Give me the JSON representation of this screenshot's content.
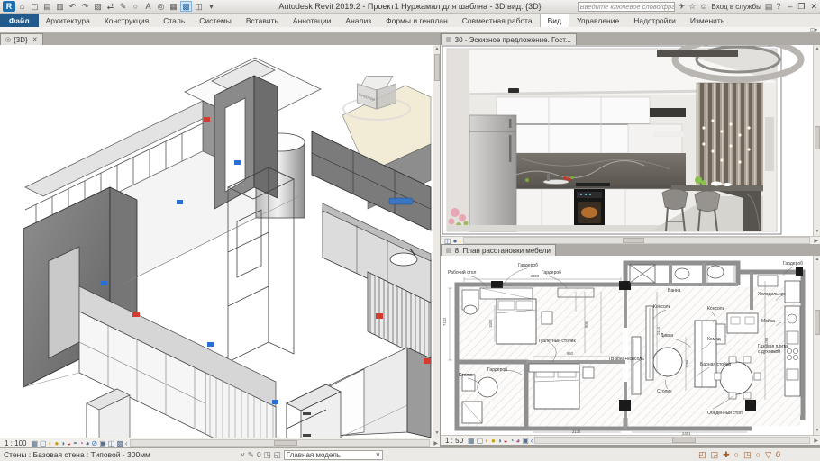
{
  "window": {
    "title": "Autodesk Revit 2019.2 - Проект1 Нуржамал для шаблна - 3D вид: {3D}"
  },
  "titlebar": {
    "search_placeholder": "Введите ключевое слово/фразу",
    "signin_label": "Вход в службы",
    "help_label": "?"
  },
  "ribbon": {
    "tabs": [
      "Файл",
      "Архитектура",
      "Конструкция",
      "Сталь",
      "Системы",
      "Вставить",
      "Аннотации",
      "Анализ",
      "Формы и генплан",
      "Совместная работа",
      "Вид",
      "Управление",
      "Надстройки",
      "Изменить"
    ],
    "active_tab": "Вид"
  },
  "panes": {
    "view3d": {
      "tab_label": "{3D}",
      "scale": "1 : 100",
      "viewcube_front": "Спереди"
    },
    "render": {
      "tab_label": "30 - Эскизное предложение. Гост..."
    },
    "plan": {
      "tab_label": "8. План расстановки мебели",
      "scale": "1 : 50",
      "labels": [
        "Рабочий стол",
        "Гардероб",
        "Гардероб",
        "Туалетный столик",
        "Гардероб",
        "Консоль",
        "Консоль",
        "Диван",
        "Комод",
        "ТВ зона+консоль",
        "Барная стойка",
        "Столик",
        "Обеденный стол",
        "Столик",
        "Ванна",
        "Гардероб",
        "Холодильник",
        "Мойка",
        "Газовая плита",
        "с духовкой"
      ],
      "dims": [
        "2060",
        "1500",
        "2132",
        "7132",
        "1298",
        "2114",
        "1079",
        "950",
        "1544",
        "2451",
        "906",
        "1298"
      ]
    }
  },
  "statusbar": {
    "message": "Стены : Базовая стена : Типовой - 300мм",
    "model_selector": "Главная модель",
    "editable_count": "0",
    "filter_count": "0"
  },
  "icons": {
    "logo": "R",
    "qat1": "⌂",
    "qat2": "▢",
    "qat3": "▤",
    "qat4": "▥",
    "qat5": "↶",
    "qat6": "↷",
    "qat7": "▨",
    "qat8": "⇄",
    "qat9": "✎",
    "qat10": "○",
    "qat11": "A",
    "qat12": "◎",
    "qat13": "▦",
    "qat14": "▩",
    "qat15": "◫",
    "qat16": "▾",
    "search_go": "▸",
    "send": "✈",
    "star": "☆",
    "person": "☺",
    "cart": "▤",
    "help": "?",
    "minimize": "–",
    "restore": "❐",
    "close": "✕",
    "sheet": "▤",
    "globe3d": "◎",
    "close_tab": "✕",
    "vcb1": "▦",
    "vcb2": "▢",
    "vcb3": "◐",
    "vcb4": "●",
    "vcb5": "◑",
    "vcb6": "◒",
    "vcb7": "◓",
    "vcb8": "◔",
    "vcb9": "◕",
    "vcb10": "⊘",
    "vcb11": "▣",
    "vcb12": "◫",
    "vcb13": "▩",
    "vcb14": "‹",
    "rvcb1": "◫",
    "rvcb2": "●",
    "rvcb3": "‹",
    "st1": "◳",
    "st2": "◱",
    "st3": "◰",
    "st4": "◲",
    "st5": "✚",
    "st6": "○",
    "st7": "▽",
    "pencil": "✎",
    "chev": "˅"
  }
}
